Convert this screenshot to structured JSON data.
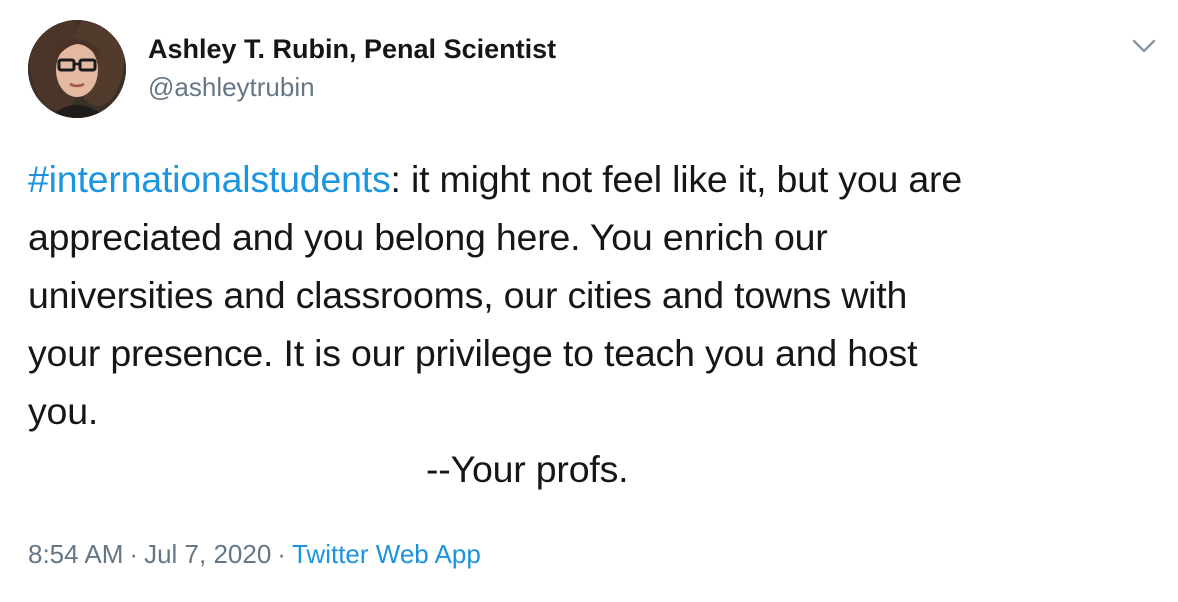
{
  "author": {
    "display_name": "Ashley T. Rubin, Penal Scientist",
    "handle": "@ashleytrubin"
  },
  "header": {
    "menu_icon": "chevron-down-icon"
  },
  "tweet": {
    "hashtag": "#internationalstudents",
    "line1_rest": ": it might not feel like it, but you are",
    "line2": "appreciated and you belong here. You enrich our",
    "line3": "universities and classrooms, our cities and towns with",
    "line4": "your presence. It is our privilege to teach you and host",
    "line5": "you.",
    "signoff": "--Your profs."
  },
  "meta": {
    "time": "8:54 AM",
    "separator": "·",
    "date": "Jul 7, 2020",
    "source": "Twitter Web App"
  },
  "colors": {
    "link": "#1b95e0",
    "secondary_text": "#657786",
    "primary_text": "#14171a"
  }
}
